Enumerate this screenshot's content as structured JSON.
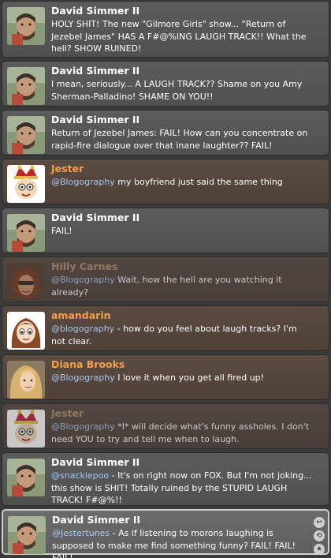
{
  "tweets": [
    {
      "author": "David Simmer II",
      "avatar": "david-avatar",
      "kind": "self",
      "mention": "",
      "text": "HOLY SHIT! The new \"Gilmore Girls\" show... \"Return of Jezebel James\" HAS A F#@%ING LAUGH TRACK!! What the hell? SHOW RUINED!"
    },
    {
      "author": "David Simmer II",
      "avatar": "david-avatar",
      "kind": "self",
      "mention": "",
      "text": "I mean, seriously... A LAUGH TRACK?? Shame on you Amy Sherman-Palladino! SHAME ON YOU!!"
    },
    {
      "author": "David Simmer II",
      "avatar": "david-avatar",
      "kind": "self",
      "mention": "",
      "text": "Return of Jezebel James: FAIL! How can you concentrate on rapid-fire dialogue over that inane laughter?? FAIL!"
    },
    {
      "author": "Jester",
      "avatar": "jester-avatar",
      "kind": "reply",
      "mention": "@Blogography",
      "text": " my boyfriend just said the same thing"
    },
    {
      "author": "David Simmer II",
      "avatar": "david-avatar",
      "kind": "self",
      "mention": "",
      "text": "FAIL!"
    },
    {
      "author": "Hilly Carnes",
      "avatar": "hilly-avatar",
      "kind": "reply faded",
      "mention": "@Blogography",
      "text": " Wait, how the hell are you watching it already?"
    },
    {
      "author": "amandarin",
      "avatar": "amandarin-avatar",
      "kind": "reply",
      "mention": "@blogography",
      "text": " - how do you feel about laugh tracks? I'm not clear."
    },
    {
      "author": "Diana Brooks",
      "avatar": "diana-avatar",
      "kind": "reply",
      "mention": "@Blogography",
      "text": " I love it when you get all fired up!"
    },
    {
      "author": "Jester",
      "avatar": "jester-avatar",
      "kind": "reply faded",
      "mention": "@Blogography",
      "text": " *I* will decide what's funny assholes. I don't need YOU to try and tell me when to laugh."
    },
    {
      "author": "David Simmer II",
      "avatar": "david-avatar",
      "kind": "self",
      "mention": "@snackiepoo",
      "text": " - It's on right now on FOX. But I'm not joking... this show is SHIT! Totally ruined by the STUPID LAUGH TRACK! F#@%!!"
    },
    {
      "author": "David Simmer II",
      "avatar": "david-avatar",
      "kind": "self selected",
      "mention": "@Jestertunes",
      "text": " - As if listening to morons laughing is supposed to make me find something funny? FAIL! FAIL! FAIL!"
    }
  ],
  "actions": {
    "reply_icon": "reply-icon",
    "retweet_icon": "retweet-icon",
    "favorite_icon": "favorite-icon"
  }
}
